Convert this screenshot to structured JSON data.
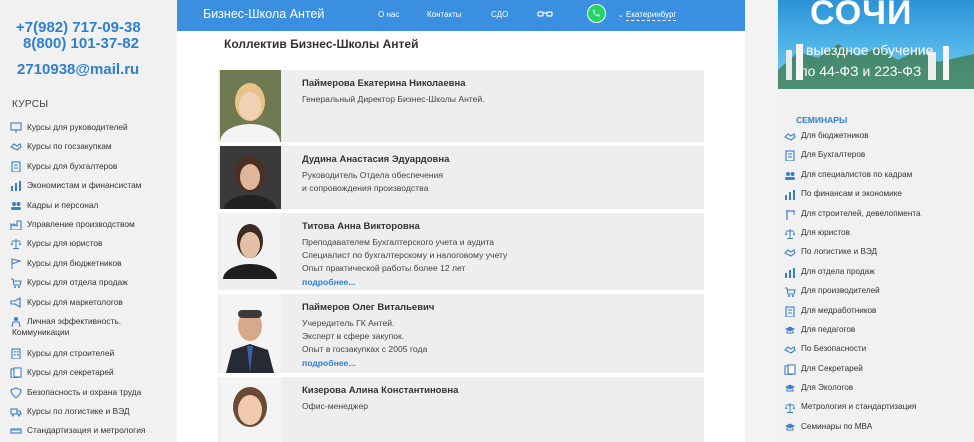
{
  "contacts": {
    "phone1": "+7(982) 717-09-38",
    "phone2": "8(800) 101-37-82",
    "email": "2710938@mail.ru"
  },
  "left_sidebar": {
    "title": "КУРСЫ",
    "items": [
      {
        "label": "Курсы для руководителей",
        "icon": "presentation-icon"
      },
      {
        "label": "Курсы по госзакупкам",
        "icon": "handshake-icon"
      },
      {
        "label": "Курсы для бухгалтеров",
        "icon": "ledger-icon"
      },
      {
        "label": "Экономистам и финансистам",
        "icon": "chart-icon"
      },
      {
        "label": "Кадры и персонал",
        "icon": "people-icon"
      },
      {
        "label": "Управление производством",
        "icon": "factory-icon"
      },
      {
        "label": "Курсы для юристов",
        "icon": "scales-icon"
      },
      {
        "label": "Курсы для бюджетников",
        "icon": "flag-icon"
      },
      {
        "label": "Курсы для отдела продаж",
        "icon": "cart-icon"
      },
      {
        "label": "Курсы для маркетологов",
        "icon": "megaphone-icon"
      },
      {
        "label": "Личная эффективность. Коммуникации",
        "icon": "person-icon",
        "line1": "Личная эффективность.",
        "line2": "Коммуникации"
      },
      {
        "label": "Курсы для строителей",
        "icon": "building-icon"
      },
      {
        "label": "Курсы для секретарей",
        "icon": "documents-icon"
      },
      {
        "label": "Безопасность и охрана труда",
        "icon": "shield-icon"
      },
      {
        "label": "Курсы по логистике и ВЭД",
        "icon": "truck-icon"
      },
      {
        "label": "Стандартизация и метрология",
        "icon": "ruler-icon"
      }
    ]
  },
  "header": {
    "brand": "Бизнес-Школа Антей",
    "nav": [
      {
        "label": "О нас"
      },
      {
        "label": "Контакты"
      },
      {
        "label": "СДО"
      }
    ],
    "city": "Екатеринбург",
    "colors": {
      "bar": "#3b8fe0",
      "whatsapp": "#25d366"
    }
  },
  "main": {
    "title": "Коллектив Бизнес-Школы Антей",
    "staff": [
      {
        "name": "Паймерова Екатерина Николаевна",
        "lines": [
          "Генеральный Директор Бизнес-Школы Антей."
        ],
        "more": ""
      },
      {
        "name": "Дудина Анастасия Эдуардовна",
        "lines": [
          "Руководитель Отдела обеспечения",
          "и сопровождения производства"
        ],
        "more": ""
      },
      {
        "name": "Титова Анна Викторовна",
        "lines": [
          "Преподавателем  Бухгалтерского учета и аудита",
          "Специалист по бухгалтерскому и налоговому учету",
          "Опыт практической работы более 12 лет"
        ],
        "more": "подробнее..."
      },
      {
        "name": "Паймеров Олег Витальевич",
        "lines": [
          "Учередитель ГК Антей.",
          "Эксперт в сфере закупок.",
          "Опыт в госзакупках с 2005 года"
        ],
        "more": "подробнее..."
      },
      {
        "name": "Кизерова Алина Константиновна",
        "lines": [
          "Офис-менеджер"
        ],
        "more": ""
      }
    ]
  },
  "right_sidebar": {
    "banner": {
      "line1": "СОЧИ",
      "line2": "выездное обучение",
      "line3": "по 44-ФЗ и 223-ФЗ"
    },
    "title": "СЕМИНАРЫ",
    "items": [
      {
        "label": "Для бюджетников",
        "icon": "handshake-icon"
      },
      {
        "label": "Для Бухгалтеров",
        "icon": "ledger-icon"
      },
      {
        "label": "Для специалистов по кадрам",
        "icon": "people-icon"
      },
      {
        "label": "По финансам и экономике",
        "icon": "chart-icon"
      },
      {
        "label": "Для строителей, девелопмента",
        "icon": "crane-icon"
      },
      {
        "label": "Для юристов",
        "icon": "scales-icon"
      },
      {
        "label": "По логистике и ВЭД",
        "icon": "handshake-icon"
      },
      {
        "label": "Для отдела продаж",
        "icon": "chart-icon"
      },
      {
        "label": "Для производителей",
        "icon": "cart-icon"
      },
      {
        "label": "Для медработников",
        "icon": "ledger-icon"
      },
      {
        "label": "Для педагогов",
        "icon": "graduation-icon"
      },
      {
        "label": "По Безопасности",
        "icon": "handshake-icon"
      },
      {
        "label": "Для Секретарей",
        "icon": "documents-icon"
      },
      {
        "label": "Для Экологов",
        "icon": "graduation-icon"
      },
      {
        "label": "Метрология и стандартизация",
        "icon": "scales-icon"
      },
      {
        "label": "Семинары по МВА",
        "icon": "graduation-icon"
      }
    ]
  },
  "colors": {
    "accent": "#2f7fd0",
    "header": "#3b8fe0",
    "card": "#eeeeee",
    "sidebar": "#f1f1f1"
  }
}
